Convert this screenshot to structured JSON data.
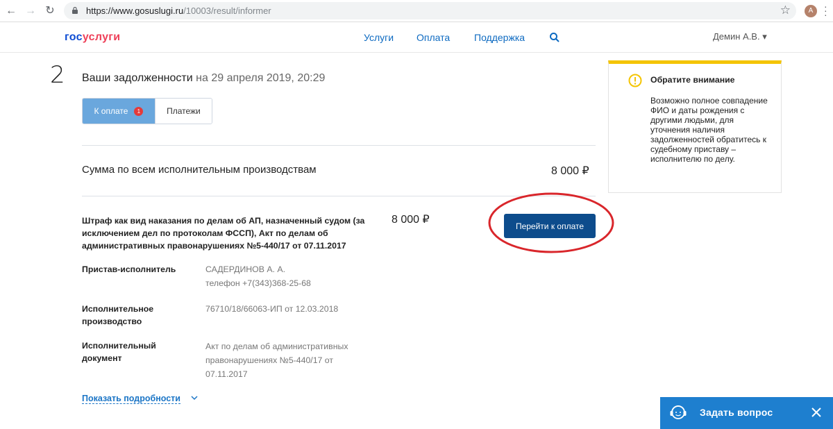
{
  "browser": {
    "url_domain": "https://www.gosuslugi.ru",
    "url_path": "/10003/result/informer",
    "profile_initial": "A"
  },
  "header": {
    "logo_part1": "гос",
    "logo_part2": "услуги",
    "nav": [
      "Услуги",
      "Оплата",
      "Поддержка"
    ],
    "user": "Демин А.В. ▾"
  },
  "main": {
    "step": "2",
    "title": "Ваши задолженности",
    "date": "на 29 апреля 2019, 20:29",
    "tabs": [
      {
        "label": "К оплате",
        "badge": "1"
      },
      {
        "label": "Платежи"
      }
    ],
    "sum_label": "Сумма по всем исполнительным производствам",
    "sum_value": "8 000 ₽",
    "fine": {
      "title": "Штраф как вид наказания по делам об АП, назначенный судом (за исключением дел по протоколам ФССП), Акт по делам об административных правонарушениях №5-440/17 от 07.11.2017",
      "amount": "8 000 ₽",
      "pay_button": "Перейти к оплате"
    },
    "rows": [
      {
        "label": "Пристав-исполнитель",
        "value_line1": "САДЕРДИНОВ А. А.",
        "value_line2": "телефон +7(343)368-25-68"
      },
      {
        "label_line1": "Исполнительное",
        "label_line2": "производство",
        "value": "76710/18/66063-ИП от 12.03.2018"
      },
      {
        "label_line1": "Исполнительный",
        "label_line2": "документ",
        "value_line1": "Акт по делам об административных",
        "value_line2": "правонарушениях №5-440/17 от",
        "value_line3": "07.11.2017"
      }
    ],
    "details_link": "Показать подробности"
  },
  "info": {
    "title": "Обратите внимание",
    "text": "Возможно полное совпадение ФИО и даты рождения с другими людьми, для уточнения наличия задолженностей обратитесь к судебному приставу – исполнителю по делу."
  },
  "chat": {
    "label": "Задать вопрос"
  },
  "colors": {
    "brand_blue": "#0d4cd3",
    "brand_red": "#ee3f58",
    "link_blue": "#0d6ac1",
    "button_dark_blue": "#0d4c8c",
    "tab_active": "#6aa7dd",
    "warning_yellow": "#f4c400",
    "chat_blue": "#1e7fcf",
    "annotation_red": "#d9262b"
  }
}
